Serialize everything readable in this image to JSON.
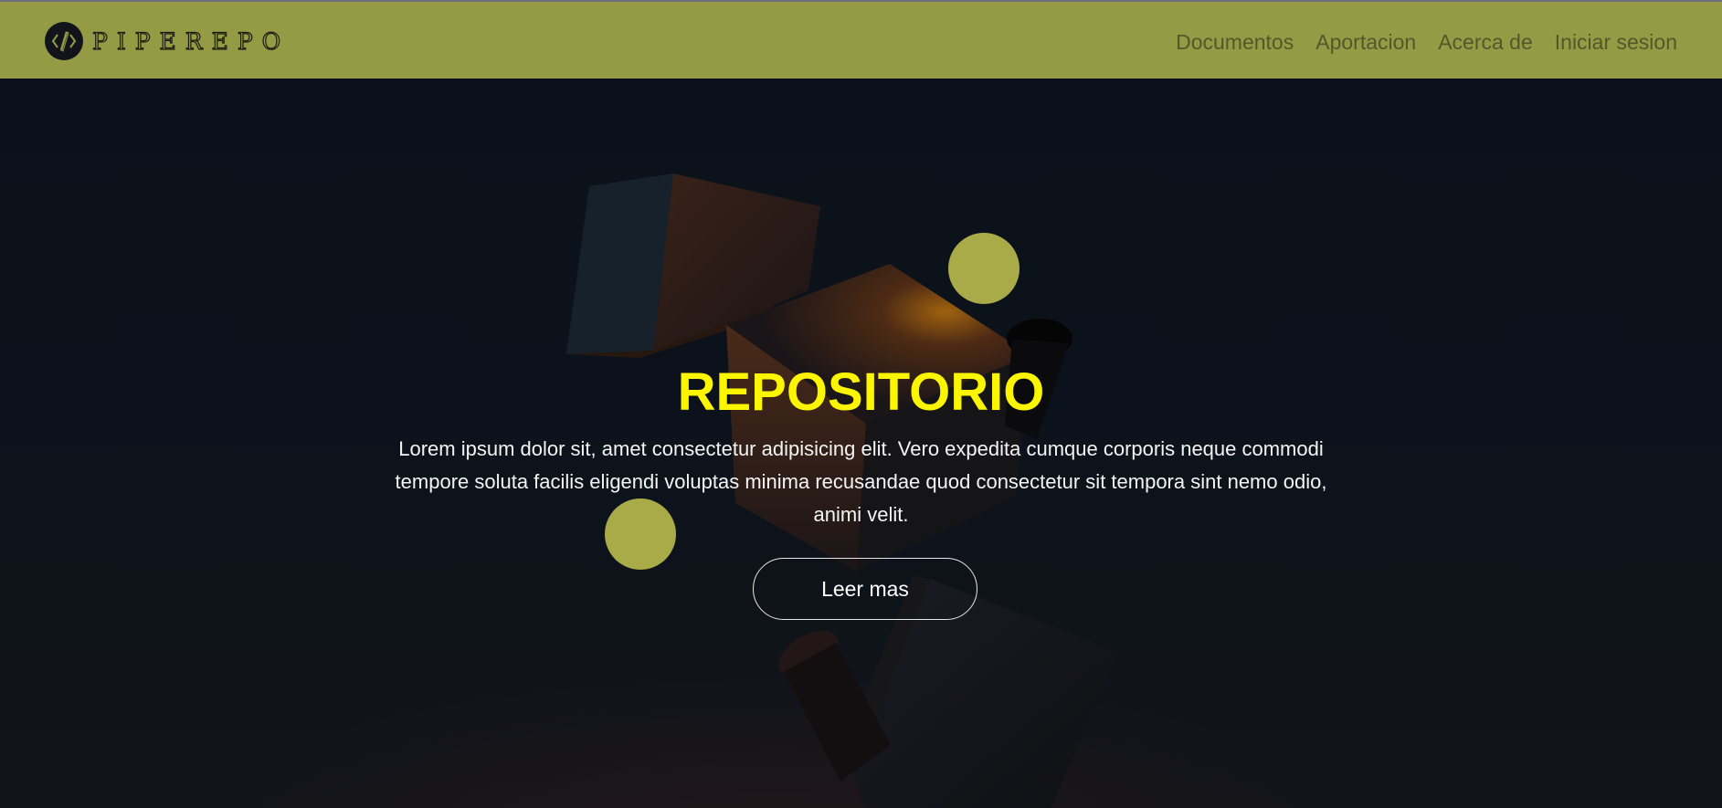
{
  "brand": {
    "name": "PIPEREPO",
    "logo_icon": "code-brackets-pencil-icon"
  },
  "nav": {
    "items": [
      {
        "label": "Documentos"
      },
      {
        "label": "Aportacion"
      },
      {
        "label": "Acerca de"
      },
      {
        "label": "Iniciar sesion"
      }
    ]
  },
  "hero": {
    "title": "REPOSITORIO",
    "text": "Lorem ipsum dolor sit, amet consectetur adipisicing elit. Vero expedita cumque corporis neque commodi tempore soluta facilis eligendi voluptas minima recusandae quod consectetur sit tempora sint nemo odio, animi velit.",
    "button_label": "Leer mas"
  },
  "colors": {
    "navbar": "#959a45",
    "accent_title": "#fcf500",
    "background": "#0c121b",
    "circle": "#a9ab48"
  }
}
